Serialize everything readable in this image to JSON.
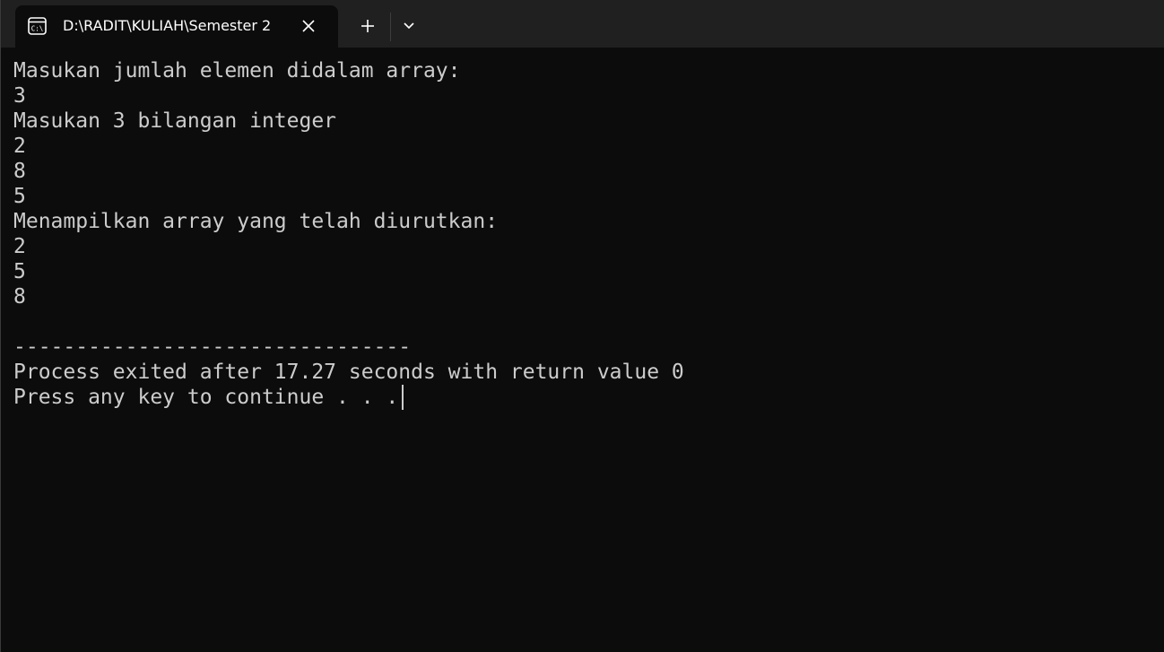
{
  "window": {
    "tab_title": "D:\\RADIT\\KULIAH\\Semester 2",
    "tab_icon": "terminal-icon",
    "icons": {
      "close": "close-icon",
      "new_tab": "plus-icon",
      "dropdown": "chevron-down-icon"
    }
  },
  "terminal": {
    "lines": [
      "Masukan jumlah elemen didalam array:",
      "3",
      "Masukan 3 bilangan integer",
      "2",
      "8",
      "5",
      "Menampilkan array yang telah diurutkan:",
      "2",
      "5",
      "8",
      "",
      "--------------------------------",
      "Process exited after 17.27 seconds with return value 0",
      "Press any key to continue . . ."
    ]
  },
  "colors": {
    "terminal_bg": "#0c0c0c",
    "titlebar_bg": "#202020",
    "text": "#cccccc"
  }
}
